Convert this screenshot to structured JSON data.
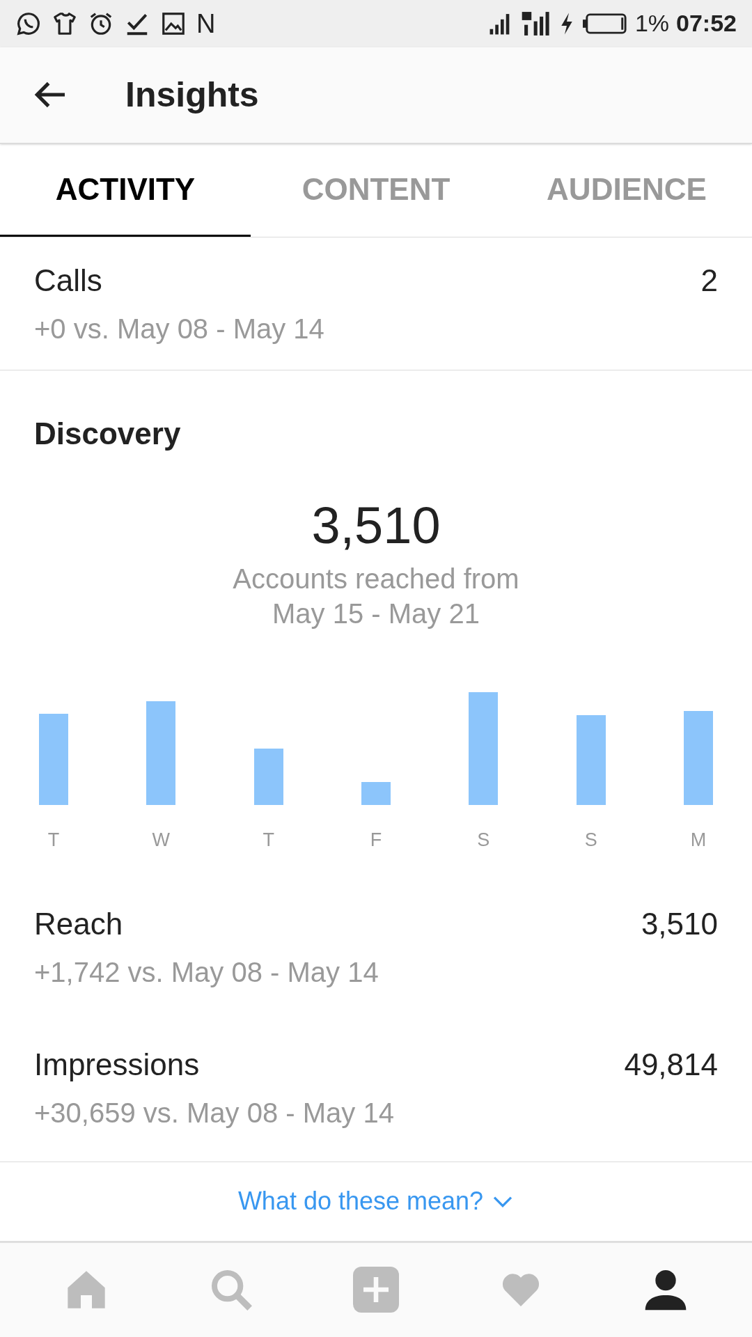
{
  "status_bar": {
    "notification_letter": "N",
    "battery": "1%",
    "time": "07:52"
  },
  "header": {
    "title": "Insights"
  },
  "tabs": [
    {
      "label": "ACTIVITY",
      "selected": true
    },
    {
      "label": "CONTENT",
      "selected": false
    },
    {
      "label": "AUDIENCE",
      "selected": false
    }
  ],
  "calls": {
    "label": "Calls",
    "value": "2",
    "comparison": "+0 vs. May 08 - May 14"
  },
  "discovery": {
    "title": "Discovery",
    "total": "3,510",
    "caption_line_1": "Accounts reached from",
    "caption_line_2": "May 15 - May 21",
    "day_labels": [
      "T",
      "W",
      "T",
      "F",
      "S",
      "S",
      "M"
    ],
    "metrics": [
      {
        "label": "Reach",
        "value": "3,510",
        "comparison": "+1,742 vs. May 08 - May 14"
      },
      {
        "label": "Impressions",
        "value": "49,814",
        "comparison": "+30,659 vs. May 08 - May 14"
      }
    ]
  },
  "help_link": "What do these mean?",
  "bottom_nav": [
    {
      "kind": "home",
      "selected": false
    },
    {
      "kind": "search",
      "selected": false
    },
    {
      "kind": "add",
      "selected": false
    },
    {
      "kind": "heart",
      "selected": false
    },
    {
      "kind": "profile",
      "selected": true
    }
  ]
}
